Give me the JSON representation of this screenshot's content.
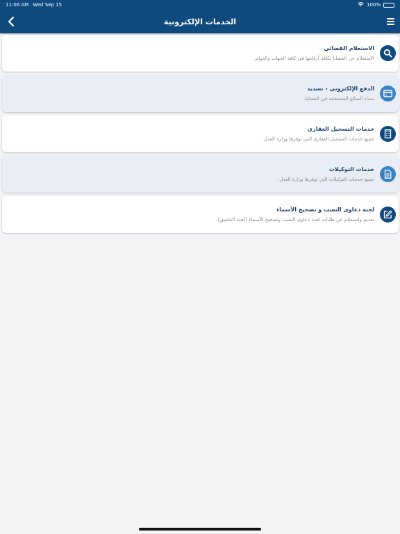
{
  "status": {
    "time": "11:06 AM",
    "date": "Wed Sep 15",
    "battery": "100%"
  },
  "header": {
    "title": "الخدمات الإلكترونية"
  },
  "colors": {
    "primary": "#0f4a7e",
    "icon_dark": "#0f4a7e",
    "icon_light": "#3a82c4",
    "card_alt": "#e9eef6"
  },
  "services": [
    {
      "title": "الاستعلام القضائي",
      "desc": "الاستعلام عن القضايا بكافة أرقامها في كافة الجهات والدوائر",
      "icon": "search-icon"
    },
    {
      "title": "الدفع الإلكتروني - تسديد",
      "desc": "سداد المبالغ المستحقة في القضايا.",
      "icon": "credit-card-icon"
    },
    {
      "title": "خدمات التسجيل العقاري",
      "desc": "جميع خدمات التسجيل العقاري التي توفرها وزارة العدل.",
      "icon": "building-icon"
    },
    {
      "title": "خدمات التوكيلات",
      "desc": "جميع خدمات التوكيلات التي توفرها وزارة العدل.",
      "icon": "document-icon"
    },
    {
      "title": "لجنة دعاوى النسب و تصحيح الأسماء",
      "desc": "تقديم واستعلام عن طلبات لجنة دعاوى النسب وتصحيح الأسماء (لجنة التحقيق).",
      "icon": "edit-icon"
    }
  ]
}
